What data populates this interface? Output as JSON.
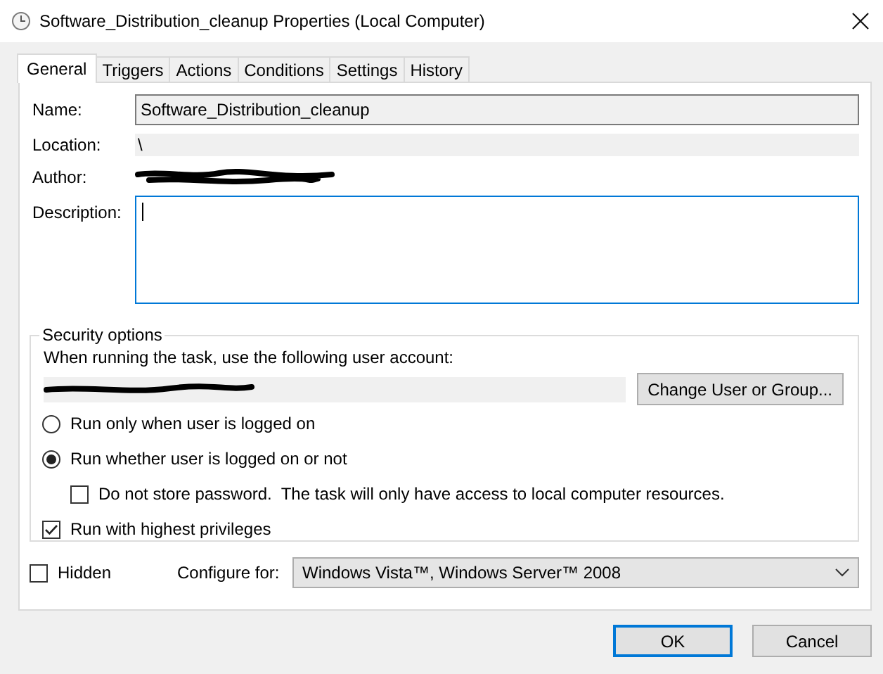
{
  "window": {
    "title": "Software_Distribution_cleanup Properties (Local Computer)"
  },
  "tabs": [
    {
      "label": "General",
      "selected": true
    },
    {
      "label": "Triggers",
      "selected": false
    },
    {
      "label": "Actions",
      "selected": false
    },
    {
      "label": "Conditions",
      "selected": false
    },
    {
      "label": "Settings",
      "selected": false
    },
    {
      "label": "History",
      "selected": false
    }
  ],
  "general": {
    "name_label": "Name:",
    "name_value": "Software_Distribution_cleanup",
    "location_label": "Location:",
    "location_value": "\\",
    "author_label": "Author:",
    "description_label": "Description:",
    "description_focused": true
  },
  "security": {
    "title": "Security options",
    "account_prompt": "When running the task, use the following user account:",
    "change_button": "Change User or Group...",
    "options": [
      {
        "kind": "radio",
        "label": "Run only when user is logged on",
        "selected": false
      },
      {
        "kind": "radio",
        "label": "Run whether user is logged on or not",
        "selected": true,
        "children": [
          {
            "kind": "checkbox",
            "label": "Do not store password.  The task will only have access to local computer resources.",
            "checked": false
          }
        ]
      },
      {
        "kind": "checkbox",
        "label": "Run with highest privileges",
        "checked": true
      }
    ]
  },
  "hidden": {
    "label": "Hidden",
    "checked": false
  },
  "configure": {
    "label": "Configure for:",
    "value": "Windows Vista™, Windows Server™ 2008"
  },
  "buttons": [
    {
      "label": "OK",
      "default": true
    },
    {
      "label": "Cancel",
      "default": false
    }
  ]
}
